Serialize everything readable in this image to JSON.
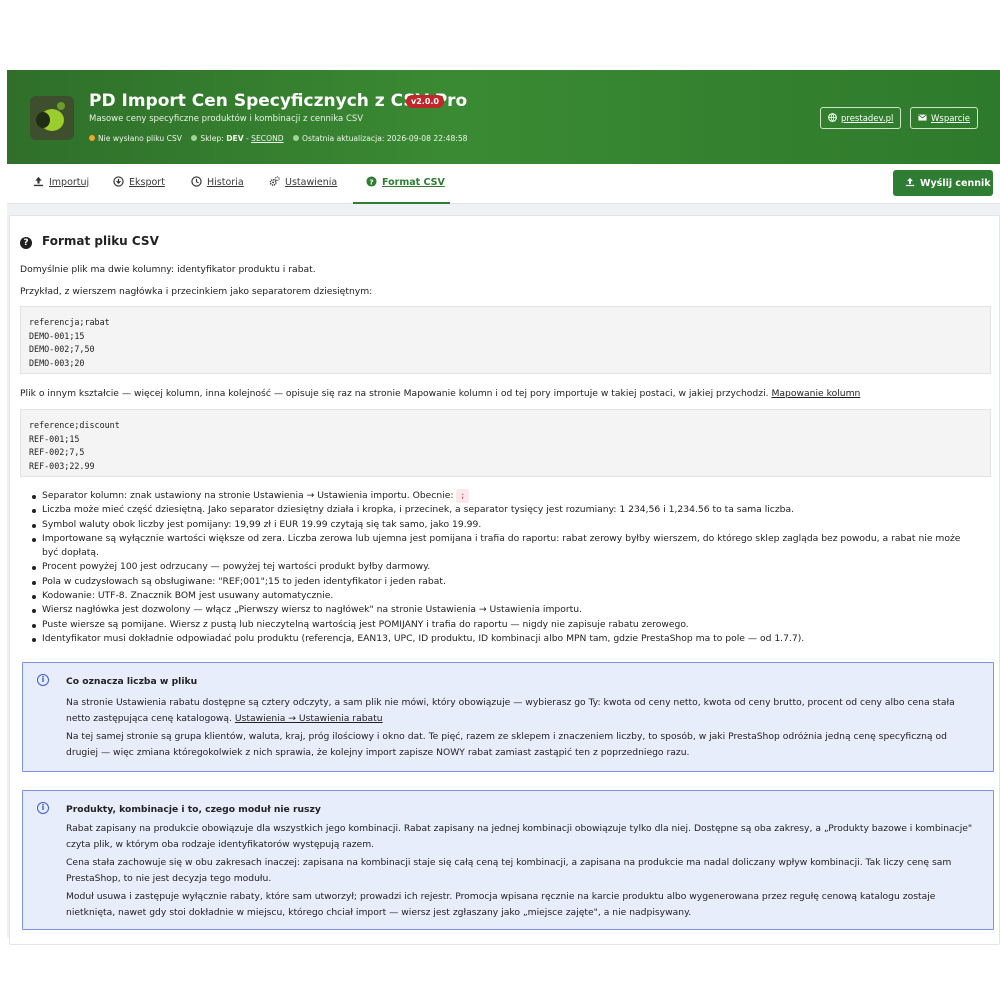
{
  "header": {
    "title": "PD Import Cen Specyficznych z CSV Pro",
    "version": "v2.0.0",
    "subtitle": "Masowe ceny specyficzne produktów i kombinacji z cennika CSV",
    "status": {
      "file_status": "Nie wysłano pliku CSV",
      "shop_label": "Sklep:",
      "shop_name": "DEV",
      "shop_sep": "-",
      "shop_theme": "SECOND",
      "last_update_label": "Ostatnia aktualizacja:",
      "last_update": "2026-09-08 22:48:58",
      "colors": {
        "file_status": "#f5a623",
        "shop": "#9fd39a",
        "last_update": "#9fd39a"
      }
    },
    "links": {
      "site": "prestadev.pl",
      "support": "Wsparcie"
    }
  },
  "tabs": [
    {
      "label": "Importuj",
      "icon": "upload-icon"
    },
    {
      "label": "Eksport",
      "icon": "download-icon"
    },
    {
      "label": "Historia",
      "icon": "clock-icon"
    },
    {
      "label": "Ustawienia",
      "icon": "gears-icon"
    },
    {
      "label": "Format CSV",
      "icon": "question-icon",
      "active": true
    }
  ],
  "send_button": "Wyślij cennik",
  "panel": {
    "title": "Format pliku CSV",
    "intro": "Domyślnie plik ma dwie kolumny: identyfikator produktu i rabat.",
    "example_intro": "Przykład, z wierszem nagłówka i przecinkiem jako separatorem dziesiętnym:",
    "code1": "referencja;rabat\nDEMO-001;15\nDEMO-002;7,50\nDEMO-003;20",
    "other_shape": "Plik o innym kształcie — więcej kolumn, inna kolejność — opisuje się raz na stronie Mapowanie kolumn i od tej pory importuje w takiej postaci, w jakiej przychodzi.",
    "other_shape_link": "Mapowanie kolumn",
    "code2": "reference;discount\nREF-001;15\nREF-002;7,5\nREF-003;22.99",
    "separator_text": "Separator kolumn: znak ustawiony na stronie Ustawienia → Ustawienia importu. Obecnie:",
    "separator_value": ";",
    "bullets": [
      "Liczba może mieć część dziesiętną. Jako separator dziesiętny działa i kropka, i przecinek, a separator tysięcy jest rozumiany: 1 234,56 i 1,234.56 to ta sama liczba.",
      "Symbol waluty obok liczby jest pomijany: 19,99 zł i EUR 19.99 czytają się tak samo, jako 19.99.",
      "Importowane są wyłącznie wartości większe od zera. Liczba zerowa lub ujemna jest pomijana i trafia do raportu: rabat zerowy byłby wierszem, do którego sklep zagląda bez powodu, a rabat nie może",
      "być dopłatą.",
      "Procent powyżej 100 jest odrzucany — powyżej tej wartości produkt byłby darmowy.",
      "Pola w cudzysłowach są obsługiwane: \"REF;001\";15 to jeden identyfikator i jeden rabat.",
      "Kodowanie: UTF-8. Znacznik BOM jest usuwany automatycznie.",
      "Wiersz nagłówka jest dozwolony — włącz „Pierwszy wiersz to nagłówek\" na stronie Ustawienia → Ustawienia importu.",
      "Puste wiersze są pomijane. Wiersz z pustą lub nieczytelną wartością jest POMIJANY i trafia do raportu — nigdy nie zapisuje rabatu zerowego.",
      "Identyfikator musi dokładnie odpowiadać polu produktu (referencja, EAN13, UPC, ID produktu, ID kombinacji albo MPN tam, gdzie PrestaShop ma to pole — od 1.7.7)."
    ],
    "note1": {
      "title": "Co oznacza liczba w pliku",
      "p1": "Na stronie Ustawienia rabatu dostępne są cztery odczyty, a sam plik nie mówi, który obowiązuje — wybierasz go Ty: kwota od ceny netto, kwota od ceny brutto, procent od ceny albo cena stała netto zastępująca cenę katalogową.",
      "p1_link": "Ustawienia → Ustawienia rabatu",
      "p2": "Na tej samej stronie są grupa klientów, waluta, kraj, próg ilościowy i okno dat. Te pięć, razem ze sklepem i znaczeniem liczby, to sposób, w jaki PrestaShop odróżnia jedną cenę specyficzną od drugiej — więc zmiana któregokolwiek z nich sprawia, że kolejny import zapisze NOWY rabat zamiast zastąpić ten z poprzedniego razu."
    },
    "note2": {
      "title": "Produkty, kombinacje i to, czego moduł nie ruszy",
      "p1": "Rabat zapisany na produkcie obowiązuje dla wszystkich jego kombinacji. Rabat zapisany na jednej kombinacji obowiązuje tylko dla niej. Dostępne są oba zakresy, a „Produkty bazowe i kombinacje\" czyta plik, w którym oba rodzaje identyfikatorów występują razem.",
      "p2": "Cena stała zachowuje się w obu zakresach inaczej: zapisana na kombinacji staje się całą ceną tej kombinacji, a zapisana na produkcie ma nadal doliczany wpływ kombinacji. Tak liczy cenę sam PrestaShop, to nie jest decyzja tego modułu.",
      "p3": "Moduł usuwa i zastępuje wyłącznie rabaty, które sam utworzył; prowadzi ich rejestr. Promocja wpisana ręcznie na karcie produktu albo wygenerowana przez regułę cenową katalogu zostaje nietknięta, nawet gdy stoi dokładnie w miejscu, którego chciał import — wiersz jest zgłaszany jako „miejsce zajęte\", a nie nadpisywany."
    }
  }
}
